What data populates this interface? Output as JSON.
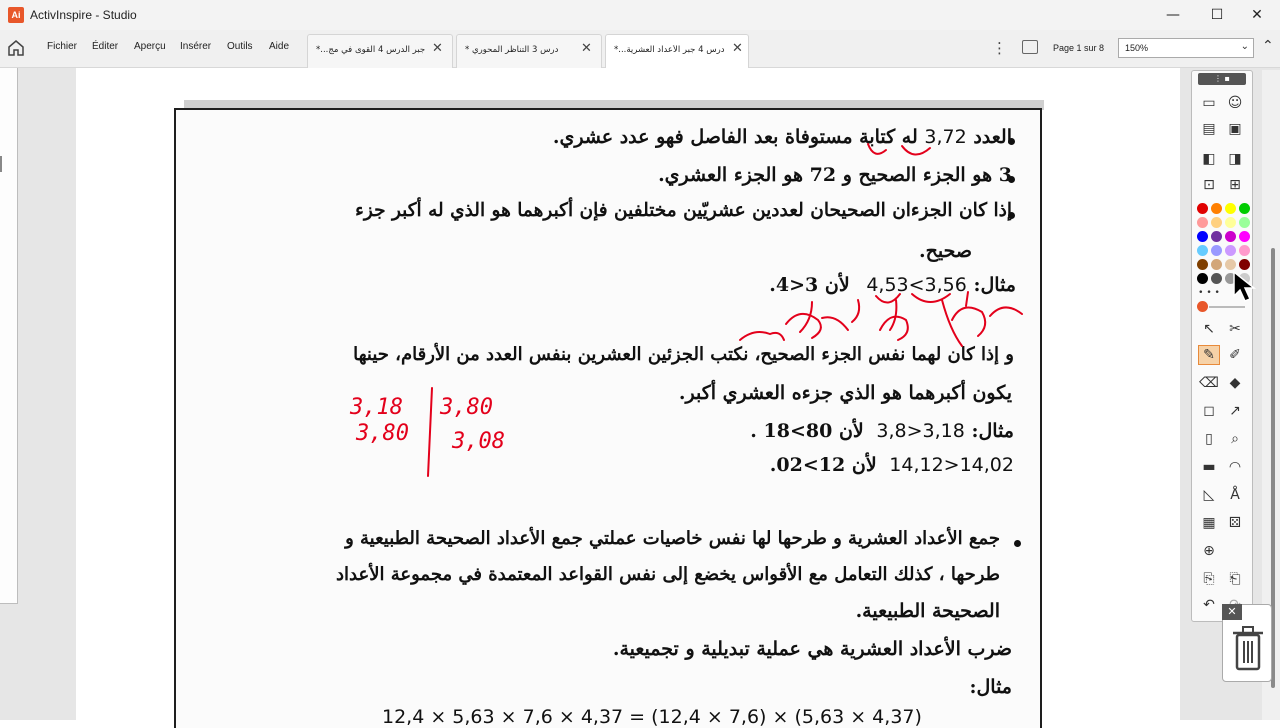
{
  "window": {
    "app_icon_text": "Ai",
    "title": "ActivInspire - Studio",
    "minimize": "—",
    "maximize": "☐",
    "close": "✕"
  },
  "menu": {
    "items": [
      "Fichier",
      "Éditer",
      "Aperçu",
      "Insérer",
      "Outils",
      "Aide"
    ]
  },
  "tabs": [
    {
      "label": "*...جبر الدرس 4 القوى في مج"
    },
    {
      "label": "* درس 3 التناظر المحوري"
    },
    {
      "label": "*...درس 4 جبر الأعداد العشرية"
    }
  ],
  "page_indicator": "Page 1 sur 8",
  "zoom": "150%",
  "document": {
    "line1_before": "العدد ",
    "line1_number": "3,72",
    "line1_after": " له كتابة مستوفاة بعد الفاصل فهو عدد عشري.",
    "line2": "3 هو الجزء الصحيح و 72 هو الجزء العشري.",
    "line3a": "إذا كان الجزءان الصحيحان لعددين عشريّين مختلفين فإن أكبرهما هو الذي له أكبر جزء",
    "line3b": "صحيح.",
    "example1_label": "مثال:",
    "example1_expr": "4,53<3,56",
    "example1_reason": "لأن 3<4.",
    "line4a": "و إذا كان لهما نفس الجزء الصحيح، نكتب الجزئين العشرين بنفس العدد من الأرقام، حينها",
    "line4b": "يكون أكبرهما هو الذي جزءه العشري أكبر.",
    "example2_label": "مثال:",
    "example2_expr": "3,8>3,18",
    "example2_reason": "لأن 80>18 .",
    "example3_expr": "14,12>14,02",
    "example3_reason": "لأن 12>02.",
    "line5a": "جمع الأعداد العشرية و طرحها لها نفس خاصيات عملتي جمع الأعداد الصحيحة الطبيعية و",
    "line5b": "طرحها ، كذلك التعامل مع الأقواس يخضع إلى نفس القواعد المعتمدة في مجموعة الأعداد",
    "line5c": "الصحيحة الطبيعية.",
    "line6": "ضرب الأعداد العشرية هي عملية تبديلية و تجميعية.",
    "example4_label": "مثال:",
    "line7_partial": "12,4 × 5,63 × 7,6 × 4,37 = (12,4 × 7,6) × (5,63 × 4,37)"
  },
  "annotations": {
    "colors": {
      "ink": "#e3001b"
    },
    "left_top": "3,18",
    "left_bottom": "3,80",
    "right_top": "3,80",
    "right_bottom": "3,08"
  },
  "toolbox": {
    "header": "⋮ ▪",
    "palette": [
      "#e00000",
      "#ff7f00",
      "#ffff00",
      "#00cc00",
      "#ff9a9a",
      "#ffd080",
      "#ffff99",
      "#99ff99",
      "#0000ff",
      "#7030a0",
      "#cc00cc",
      "#ff00ff",
      "#66ccff",
      "#9999ff",
      "#cc99ff",
      "#ff99cc",
      "#7f3f00",
      "#d2a679",
      "#e6c9a8",
      "#800000",
      "#000000",
      "#555555",
      "#999999",
      "#cccccc"
    ],
    "close": "✕"
  }
}
